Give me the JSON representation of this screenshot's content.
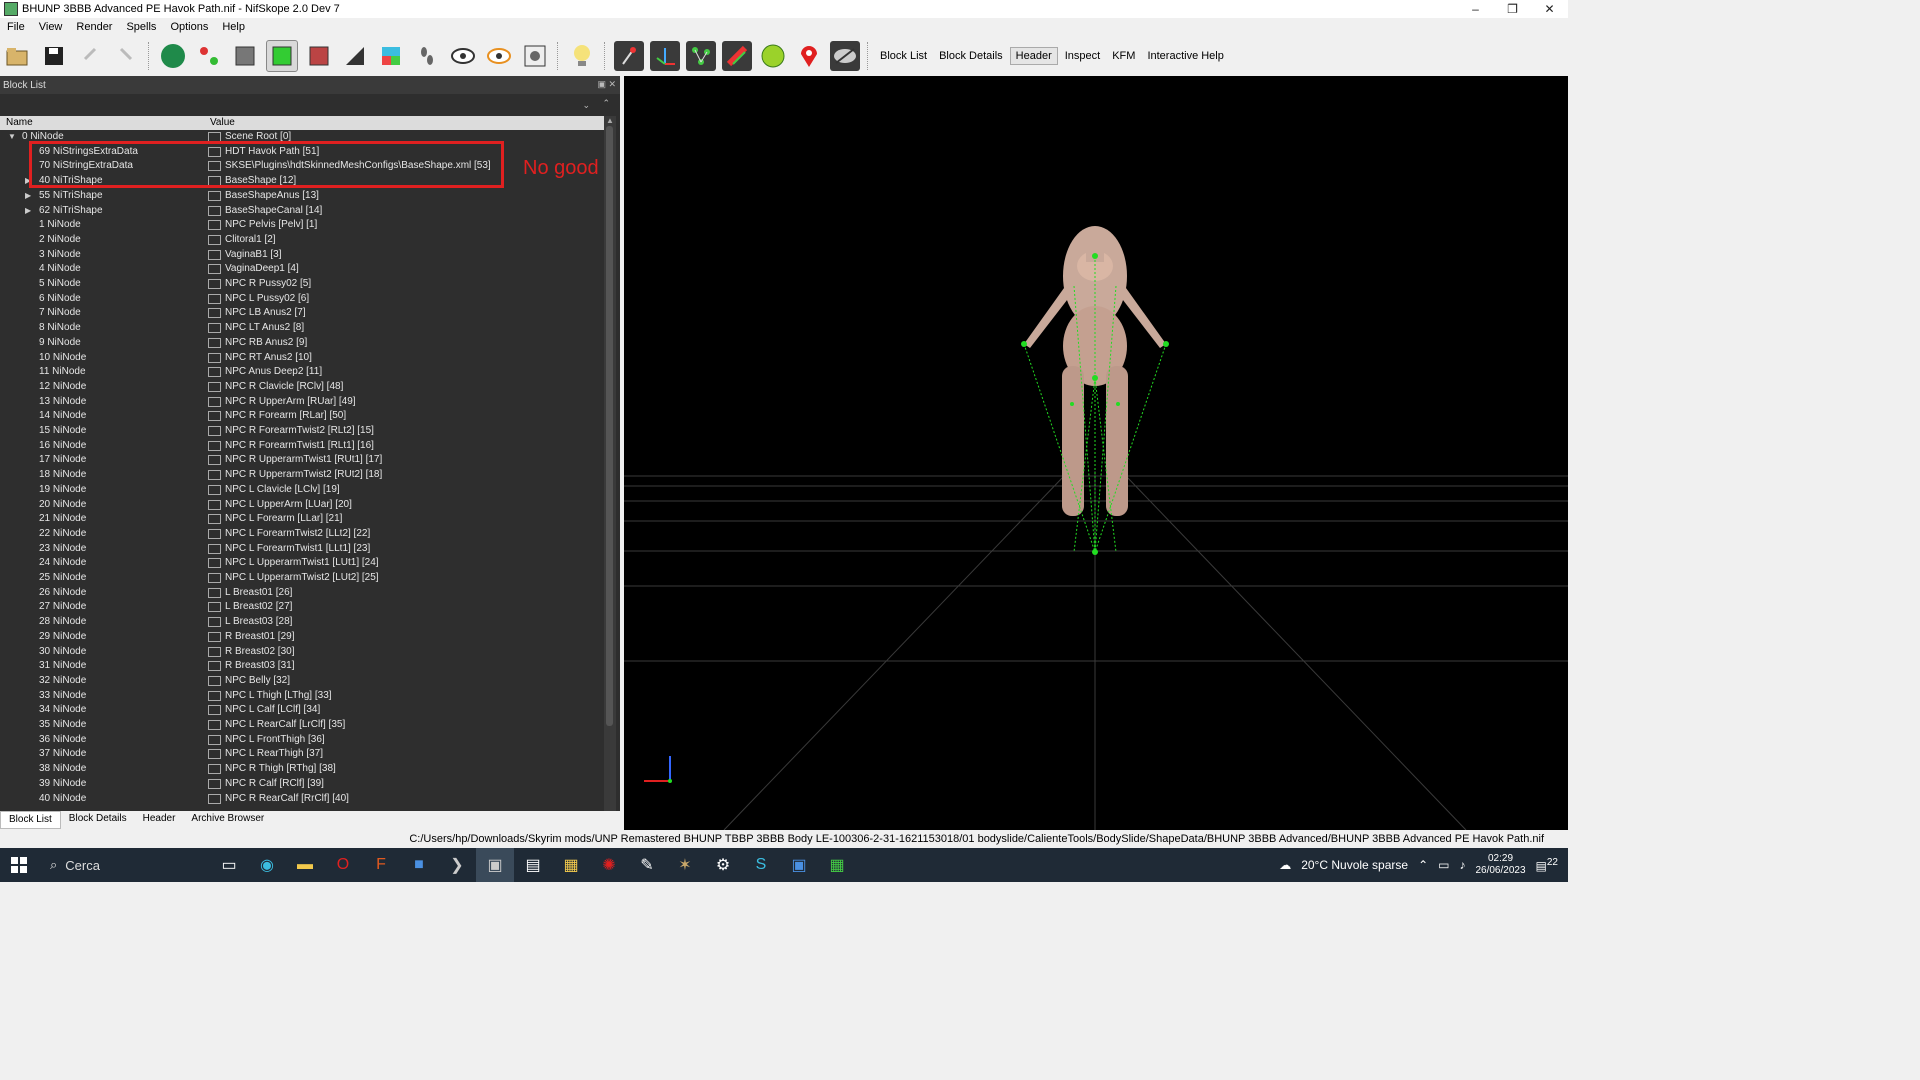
{
  "window": {
    "title": "BHUNP 3BBB Advanced PE Havok Path.nif - NifSkope 2.0 Dev 7",
    "minimize": "–",
    "maximize": "❐",
    "close": "✕"
  },
  "menu": [
    "File",
    "View",
    "Render",
    "Spells",
    "Options",
    "Help"
  ],
  "toolbar_tabs": {
    "block_list": "Block List",
    "block_details": "Block Details",
    "header": "Header",
    "inspect": "Inspect",
    "kfm": "KFM",
    "help": "Interactive Help"
  },
  "block_list": {
    "title": "Block List",
    "col_name": "Name",
    "col_value": "Value",
    "root": {
      "name": "0 NiNode",
      "value": "Scene Root [0]"
    },
    "rows": [
      {
        "name": "69 NiStringsExtraData",
        "value": "HDT Havok Path [51]"
      },
      {
        "name": "70 NiStringExtraData",
        "value": "SKSE\\Plugins\\hdtSkinnedMeshConfigs\\BaseShape.xml [53]"
      },
      {
        "name": "40 NiTriShape",
        "value": "BaseShape [12]"
      },
      {
        "name": "55 NiTriShape",
        "value": "BaseShapeAnus [13]"
      },
      {
        "name": "62 NiTriShape",
        "value": "BaseShapeCanal [14]"
      },
      {
        "name": "1 NiNode",
        "value": "NPC Pelvis [Pelv] [1]"
      },
      {
        "name": "2 NiNode",
        "value": "Clitoral1 [2]"
      },
      {
        "name": "3 NiNode",
        "value": "VaginaB1 [3]"
      },
      {
        "name": "4 NiNode",
        "value": "VaginaDeep1 [4]"
      },
      {
        "name": "5 NiNode",
        "value": "NPC R Pussy02 [5]"
      },
      {
        "name": "6 NiNode",
        "value": "NPC L Pussy02 [6]"
      },
      {
        "name": "7 NiNode",
        "value": "NPC LB Anus2 [7]"
      },
      {
        "name": "8 NiNode",
        "value": "NPC LT Anus2 [8]"
      },
      {
        "name": "9 NiNode",
        "value": "NPC RB Anus2 [9]"
      },
      {
        "name": "10 NiNode",
        "value": "NPC RT Anus2 [10]"
      },
      {
        "name": "11 NiNode",
        "value": "NPC Anus Deep2 [11]"
      },
      {
        "name": "12 NiNode",
        "value": "NPC R Clavicle [RClv] [48]"
      },
      {
        "name": "13 NiNode",
        "value": "NPC R UpperArm [RUar] [49]"
      },
      {
        "name": "14 NiNode",
        "value": "NPC R Forearm [RLar] [50]"
      },
      {
        "name": "15 NiNode",
        "value": "NPC R ForearmTwist2 [RLt2] [15]"
      },
      {
        "name": "16 NiNode",
        "value": "NPC R ForearmTwist1 [RLt1] [16]"
      },
      {
        "name": "17 NiNode",
        "value": "NPC R UpperarmTwist1 [RUt1] [17]"
      },
      {
        "name": "18 NiNode",
        "value": "NPC R UpperarmTwist2 [RUt2] [18]"
      },
      {
        "name": "19 NiNode",
        "value": "NPC L Clavicle [LClv] [19]"
      },
      {
        "name": "20 NiNode",
        "value": "NPC L UpperArm [LUar] [20]"
      },
      {
        "name": "21 NiNode",
        "value": "NPC L Forearm [LLar] [21]"
      },
      {
        "name": "22 NiNode",
        "value": "NPC L ForearmTwist2 [LLt2] [22]"
      },
      {
        "name": "23 NiNode",
        "value": "NPC L ForearmTwist1 [LLt1] [23]"
      },
      {
        "name": "24 NiNode",
        "value": "NPC L UpperarmTwist1 [LUt1] [24]"
      },
      {
        "name": "25 NiNode",
        "value": "NPC L UpperarmTwist2 [LUt2] [25]"
      },
      {
        "name": "26 NiNode",
        "value": "L Breast01 [26]"
      },
      {
        "name": "27 NiNode",
        "value": "L Breast02 [27]"
      },
      {
        "name": "28 NiNode",
        "value": "L Breast03 [28]"
      },
      {
        "name": "29 NiNode",
        "value": "R Breast01 [29]"
      },
      {
        "name": "30 NiNode",
        "value": "R Breast02 [30]"
      },
      {
        "name": "31 NiNode",
        "value": "R Breast03 [31]"
      },
      {
        "name": "32 NiNode",
        "value": "NPC Belly [32]"
      },
      {
        "name": "33 NiNode",
        "value": "NPC L Thigh [LThg] [33]"
      },
      {
        "name": "34 NiNode",
        "value": "NPC L Calf [LClf] [34]"
      },
      {
        "name": "35 NiNode",
        "value": "NPC L RearCalf [LrClf] [35]"
      },
      {
        "name": "36 NiNode",
        "value": "NPC L FrontThigh [36]"
      },
      {
        "name": "37 NiNode",
        "value": "NPC L RearThigh [37]"
      },
      {
        "name": "38 NiNode",
        "value": "NPC R Thigh [RThg] [38]"
      },
      {
        "name": "39 NiNode",
        "value": "NPC R Calf [RClf] [39]"
      },
      {
        "name": "40 NiNode",
        "value": "NPC R RearCalf [RrClf] [40]"
      }
    ]
  },
  "annotation": "No good",
  "bottom_tabs": [
    "Block List",
    "Block Details",
    "Header",
    "Archive Browser"
  ],
  "status_path": "C:/Users/hp/Downloads/Skyrim mods/UNP Remastered BHUNP TBBP 3BBB Body LE-100306-2-31-1621153018/01 bodyslide/CalienteTools/BodySlide/ShapeData/BHUNP 3BBB Advanced/BHUNP 3BBB Advanced PE Havok Path.nif",
  "taskbar": {
    "search": "Cerca",
    "weather": "20°C  Nuvole sparse",
    "time": "02:29",
    "date": "26/06/2023",
    "notif": "22"
  },
  "colors": {
    "highlight": "#e02020",
    "skeleton": "#22dd22",
    "viewport_bg": "#000000",
    "panel_bg": "#2e2e2e"
  }
}
